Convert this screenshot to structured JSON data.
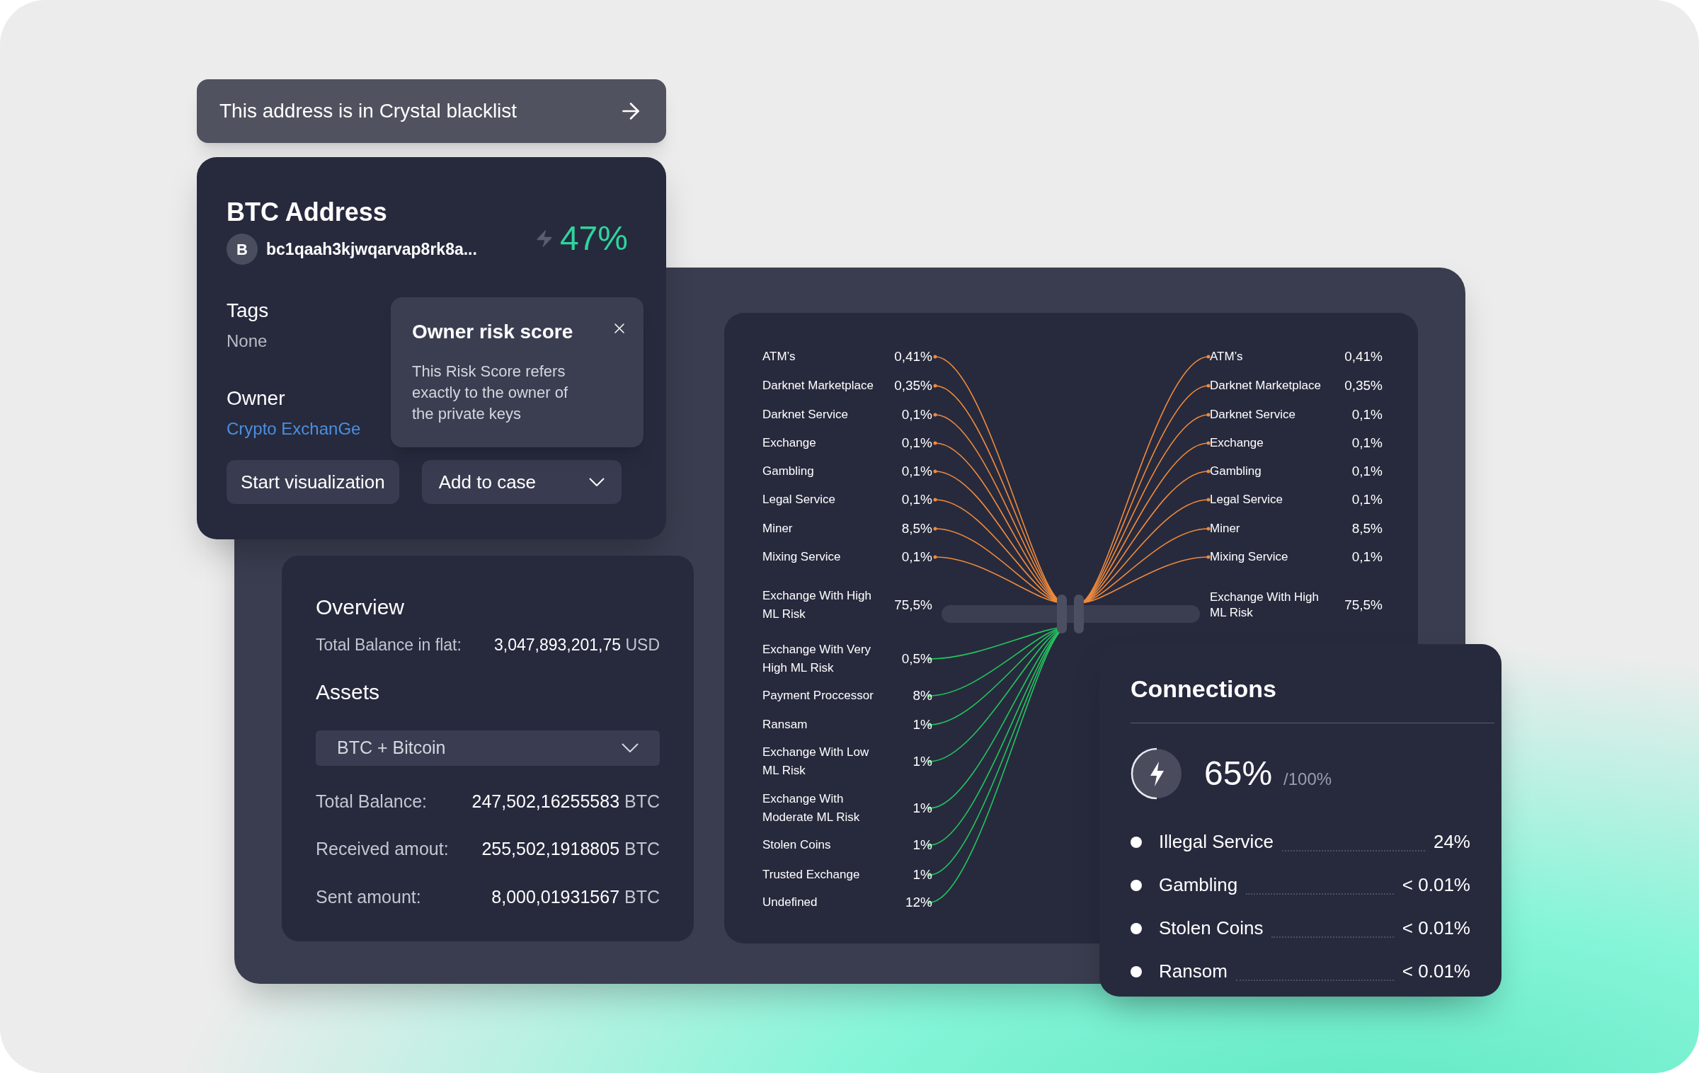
{
  "blacklist_banner": {
    "text": "This address is in Crystal blacklist"
  },
  "address_card": {
    "title": "BTC Address",
    "coin_badge": "B",
    "address": "bc1qaah3kjwqarvap8rk8a...",
    "risk_score": "47%",
    "tags_label": "Tags",
    "tags_value": "None",
    "owner_label": "Owner",
    "owner_value": "Crypto ExchanGe",
    "buttons": [
      "Start visualization",
      "Add to case"
    ]
  },
  "tooltip": {
    "title": "Owner risk score",
    "text": "This Risk Score refers exactly to the owner of the private keys"
  },
  "overview": {
    "title": "Overview",
    "fiat_label": "Total Balance in flat:",
    "fiat_amount": "3,047,893,201,75",
    "fiat_unit": "USD",
    "assets_title": "Assets",
    "asset_select": "BTC + Bitcoin",
    "rows": [
      {
        "label": "Total Balance:",
        "amount": "247,502,16255583",
        "unit": "BTC"
      },
      {
        "label": "Received amout:",
        "amount": "255,502,1918805",
        "unit": "BTC"
      },
      {
        "label": "Sent amount:",
        "amount": "8,000,01931567",
        "unit": "BTC"
      }
    ]
  },
  "flows": {
    "left": [
      {
        "label": "ATM’s",
        "value": "0,41%",
        "color": "#f08a3c"
      },
      {
        "label": "Darknet Marketplace",
        "value": "0,35%",
        "color": "#f08a3c"
      },
      {
        "label": "Darknet Service",
        "value": "0,1%",
        "color": "#f08a3c"
      },
      {
        "label": "Exchange",
        "value": "0,1%",
        "color": "#f08a3c"
      },
      {
        "label": "Gambling",
        "value": "0,1%",
        "color": "#f08a3c"
      },
      {
        "label": "Legal Service",
        "value": "0,1%",
        "color": "#f08a3c"
      },
      {
        "label": "Miner",
        "value": "8,5%",
        "color": "#f08a3c"
      },
      {
        "label": "Mixing Service",
        "value": "0,1%",
        "color": "#f08a3c"
      },
      {
        "label": "Exchange With High ML Risk",
        "value": "75,5%"
      },
      {
        "label": "Exchange With Very High ML Risk",
        "value": "0,5%",
        "color": "#22c55e"
      },
      {
        "label": "Payment Proccessor",
        "value": "8%",
        "color": "#22c55e"
      },
      {
        "label": "Ransam",
        "value": "1%",
        "color": "#22c55e"
      },
      {
        "label": "Exchange With Low ML Risk",
        "value": "1%",
        "color": "#22c55e"
      },
      {
        "label": "Exchange With Moderate ML Risk",
        "value": "1%",
        "color": "#22c55e"
      },
      {
        "label": "Stolen Coins",
        "value": "1%",
        "color": "#22c55e"
      },
      {
        "label": "Trusted Exchange",
        "value": "1%",
        "color": "#22c55e"
      },
      {
        "label": "Undefined",
        "value": "12%",
        "color": "#22c55e"
      }
    ],
    "right": [
      {
        "label": "ATM’s",
        "value": "0,41%",
        "color": "#f08a3c"
      },
      {
        "label": "Darknet Marketplace",
        "value": "0,35%",
        "color": "#f08a3c"
      },
      {
        "label": "Darknet Service",
        "value": "0,1%",
        "color": "#f08a3c"
      },
      {
        "label": "Exchange",
        "value": "0,1%",
        "color": "#f08a3c"
      },
      {
        "label": "Gambling",
        "value": "0,1%",
        "color": "#f08a3c"
      },
      {
        "label": "Legal Service",
        "value": "0,1%",
        "color": "#f08a3c"
      },
      {
        "label": "Miner",
        "value": "8,5%",
        "color": "#f08a3c"
      },
      {
        "label": "Mixing Service",
        "value": "0,1%",
        "color": "#f08a3c"
      },
      {
        "label": "Exchange With High ML Risk",
        "value": "75,5%"
      }
    ]
  },
  "connections": {
    "title": "Connections",
    "score": "65%",
    "score_max": "/100%",
    "items": [
      {
        "label": "Illegal Service",
        "value": "24%"
      },
      {
        "label": "Gambling",
        "value": "< 0.01%"
      },
      {
        "label": "Stolen Coins",
        "value": "< 0.01%"
      },
      {
        "label": "Ransom",
        "value": "< 0.01%"
      }
    ]
  }
}
